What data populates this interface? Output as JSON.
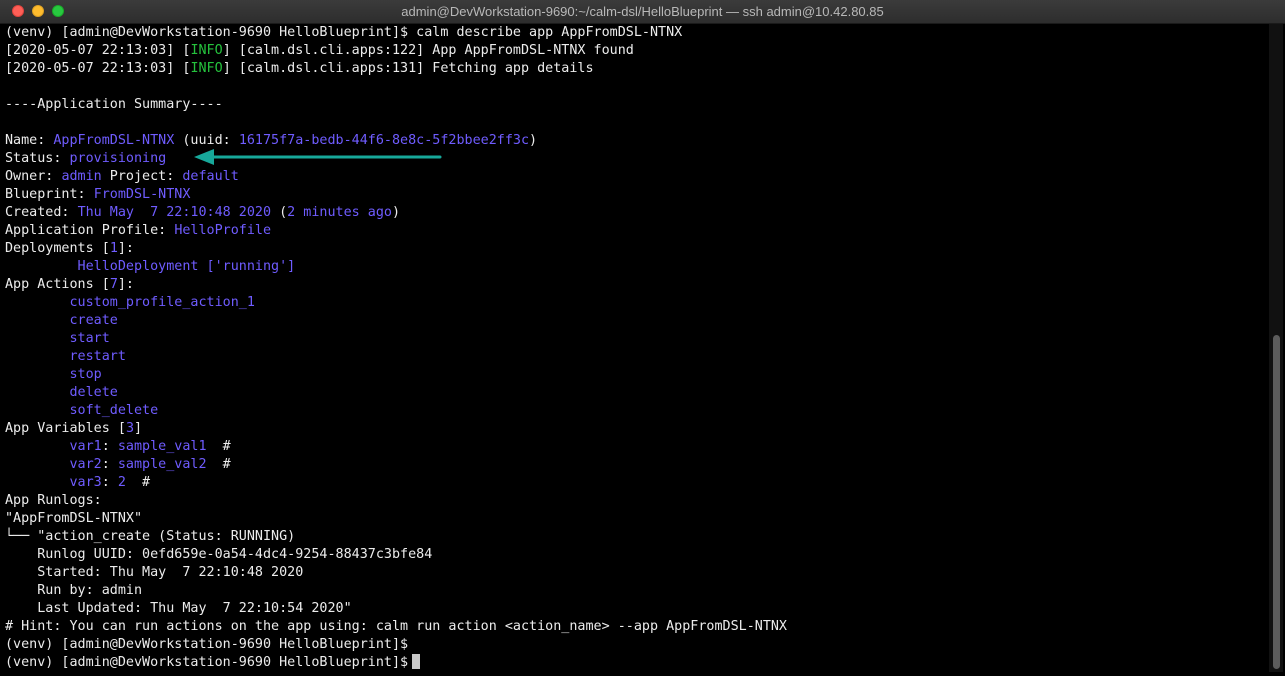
{
  "window": {
    "title": "admin@DevWorkstation-9690:~/calm-dsl/HelloBlueprint — ssh admin@10.42.80.85"
  },
  "colors": {
    "accent": "#6f5cff",
    "info": "#25c23d",
    "arrow": "#17a89a",
    "text": "#ececec",
    "background": "#000000"
  },
  "terminal": {
    "cmd": "(venv) [admin@DevWorkstation-9690 HelloBlueprint]$ calm describe app AppFromDSL-NTNX",
    "log1": {
      "ts": "[2020-05-07 22:13:03] [",
      "level": "INFO",
      "msg": "] [calm.dsl.cli.apps:122] App AppFromDSL-NTNX found"
    },
    "log2": {
      "ts": "[2020-05-07 22:13:03] [",
      "level": "INFO",
      "msg": "] [calm.dsl.cli.apps:131] Fetching app details"
    },
    "summary_header": "----Application Summary----",
    "name": {
      "label": "Name: ",
      "value": "AppFromDSL-NTNX",
      "mid": " (uuid: ",
      "uuid": "16175f7a-bedb-44f6-8e8c-5f2bbee2ff3c",
      "end": ")"
    },
    "status": {
      "label": "Status: ",
      "value": "provisioning"
    },
    "owner": {
      "label": "Owner: ",
      "value": "admin",
      "project_label": " Project: ",
      "project": "default"
    },
    "blueprint": {
      "label": "Blueprint: ",
      "value": "FromDSL-NTNX"
    },
    "created": {
      "label": "Created: ",
      "value": "Thu May  7 22:10:48 2020",
      "mid": " (",
      "ago": "2 minutes ago",
      "end": ")"
    },
    "profile": {
      "label": "Application Profile: ",
      "value": "HelloProfile"
    },
    "deployments": {
      "label": "Deployments [",
      "count": "1",
      "end": "]:",
      "item": "         HelloDeployment ['running']"
    },
    "actions": {
      "label": "App Actions [",
      "count": "7",
      "end": "]:",
      "items": [
        "custom_profile_action_1",
        "create",
        "start",
        "restart",
        "stop",
        "delete",
        "soft_delete"
      ]
    },
    "variables": {
      "label": "App Variables [",
      "count": "3",
      "end": "]",
      "items": [
        {
          "name": "var1",
          "sep": ": ",
          "value": "sample_val1",
          "comment": "  #"
        },
        {
          "name": "var2",
          "sep": ": ",
          "value": "sample_val2",
          "comment": "  #"
        },
        {
          "name": "var3",
          "sep": ": ",
          "value": "2",
          "comment": "  #"
        }
      ]
    },
    "runlogs": {
      "label": "App Runlogs:",
      "app": "\"AppFromDSL-NTNX\"",
      "action": "└── \"action_create (Status: RUNNING)",
      "uuid": "    Runlog UUID: 0efd659e-0a54-4dc4-9254-88437c3bfe84",
      "started": "    Started: Thu May  7 22:10:48 2020",
      "run_by": "    Run by: admin",
      "updated": "    Last Updated: Thu May  7 22:10:54 2020\""
    },
    "hint": "# Hint: You can run actions on the app using: calm run action <action_name> --app AppFromDSL-NTNX",
    "prompt1": "(venv) [admin@DevWorkstation-9690 HelloBlueprint]$",
    "prompt2": "(venv) [admin@DevWorkstation-9690 HelloBlueprint]$"
  }
}
